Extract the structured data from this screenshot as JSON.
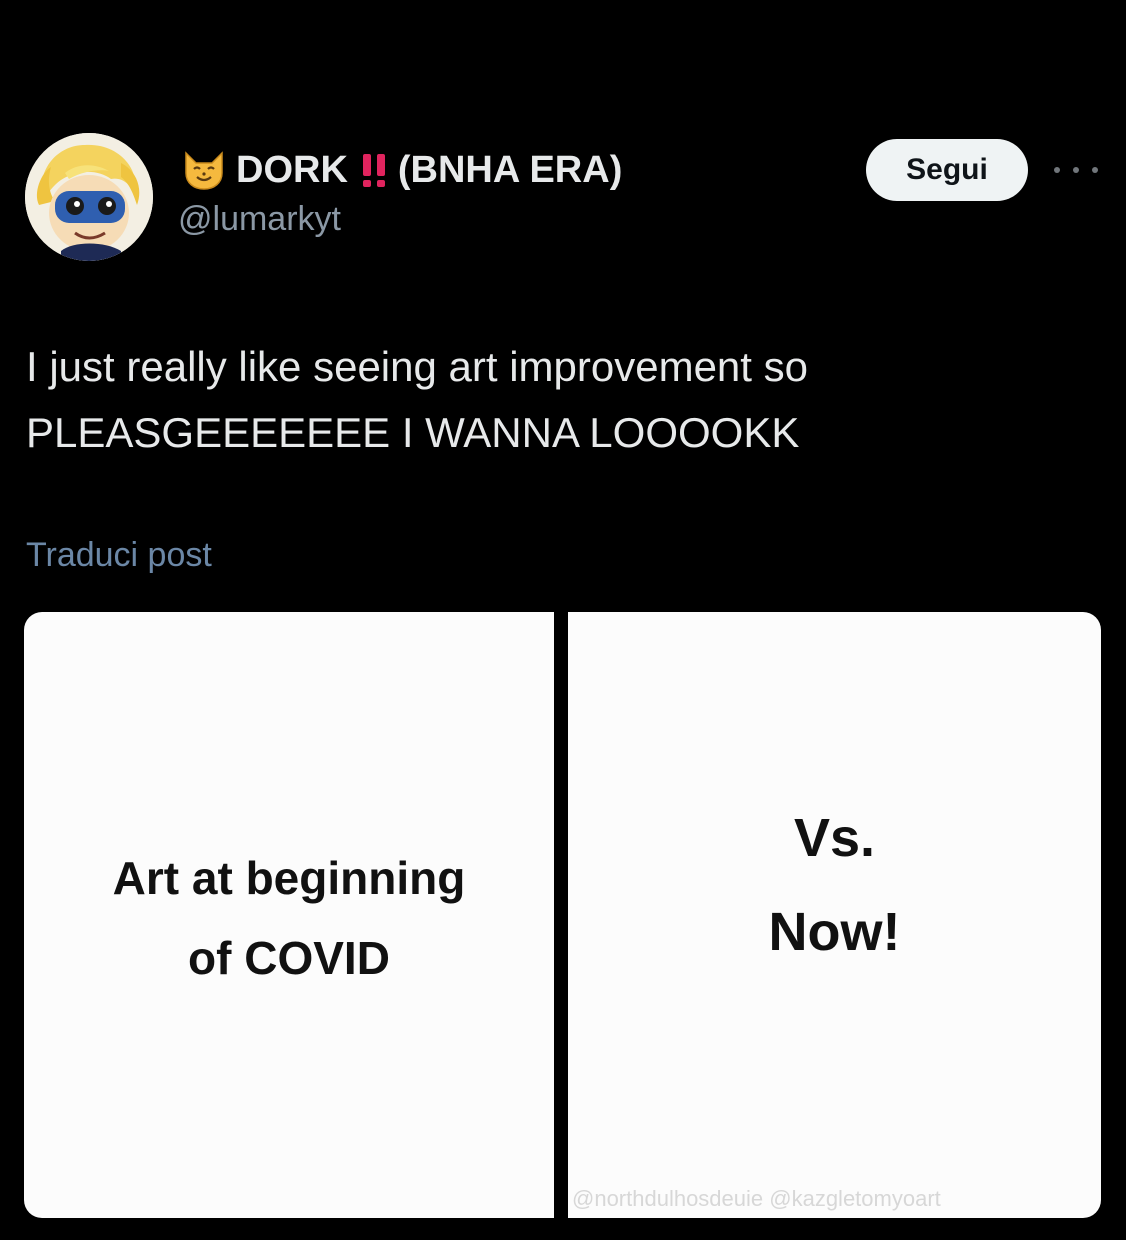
{
  "author": {
    "display_name": "DORK",
    "display_suffix": "(BNHA ERA)",
    "handle": "@lumarkyt",
    "avatar_icon": "cartoon-avatar-icon",
    "emoji_icon": "smiling-cat-icon",
    "badge_icon": "double-exclamation-icon"
  },
  "actions": {
    "follow_label": "Segui",
    "more_icon": "more-options-icon"
  },
  "post": {
    "line1": "I just really like seeing art improvement so",
    "line2": "PLEASGEEEEEEE I WANNA LOOOOKK",
    "translate_label": "Traduci post"
  },
  "media": {
    "left_line1": "Art at beginning",
    "left_line2": "of COVID",
    "right_line1": "Vs.",
    "right_line2": "Now!",
    "watermark": "@northdulhosdeuie @kazgletomyoart"
  },
  "colors": {
    "background": "#000000",
    "text": "#e7e9ea",
    "secondary": "#8b98a5",
    "link": "#6b87a6",
    "bang": "#e0245e"
  }
}
